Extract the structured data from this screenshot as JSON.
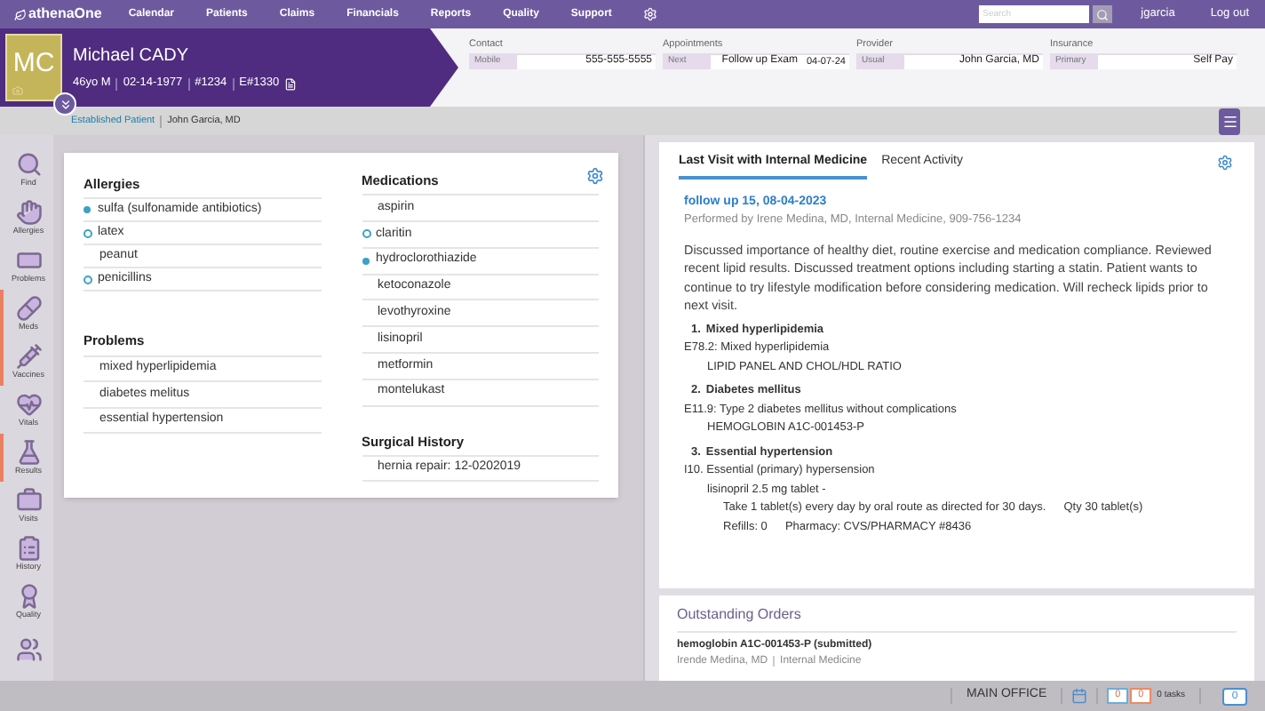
{
  "nav": {
    "logo": "athenaOne",
    "items": [
      "Calendar",
      "Patients",
      "Claims",
      "Financials",
      "Reports",
      "Quality",
      "Support"
    ],
    "search": {
      "placeholder": "Search"
    },
    "user": "jgarcia",
    "logout": "Log out"
  },
  "patient": {
    "initials": "MC",
    "name": "Michael CADY",
    "details": [
      "46yo M",
      "02-14-1977",
      "#1234",
      "E#1330"
    ],
    "fields": [
      {
        "heading": "Contact",
        "label": "Mobile",
        "value": "555-555-5555"
      },
      {
        "heading": "Appointments",
        "label": "Next",
        "value": "Follow up Exam",
        "extra": "04-07-24"
      },
      {
        "heading": "Provider",
        "label": "Usual",
        "value": "John Garcia, MD"
      },
      {
        "heading": "Insurance",
        "label": "Primary",
        "value": "Self Pay"
      }
    ],
    "status": "Established Patient",
    "provider": "John Garcia, MD"
  },
  "sidebar": [
    {
      "label": "Find",
      "flagged": false
    },
    {
      "label": "Allergies",
      "flagged": false
    },
    {
      "label": "Problems",
      "flagged": false
    },
    {
      "label": "Meds",
      "flagged": true
    },
    {
      "label": "Vaccines",
      "flagged": true
    },
    {
      "label": "Vitals",
      "flagged": false
    },
    {
      "label": "Results",
      "flagged": true
    },
    {
      "label": "Visits",
      "flagged": false
    },
    {
      "label": "History",
      "flagged": false
    },
    {
      "label": "Quality",
      "flagged": false
    },
    {
      "flagged": false
    }
  ],
  "summary": {
    "allergies": {
      "title": "Allergies",
      "items": [
        {
          "text": "sulfa (sulfonamide antibiotics)",
          "kind": "filled"
        },
        {
          "text": "latex",
          "kind": "hollow"
        },
        {
          "text": "peanut",
          "kind": "plain"
        },
        {
          "text": "penicillins",
          "kind": "hollow"
        }
      ]
    },
    "problems": {
      "title": "Problems",
      "items": [
        {
          "text": "mixed hyperlipidemia"
        },
        {
          "text": "diabetes melitus"
        },
        {
          "text": "essential hypertension"
        }
      ]
    },
    "medications": {
      "title": "Medications",
      "items": [
        {
          "text": "aspirin",
          "kind": "plain"
        },
        {
          "text": "claritin",
          "kind": "hollow"
        },
        {
          "text": "hydroclorothiazide",
          "kind": "filled"
        },
        {
          "text": "ketoconazole",
          "kind": "plain"
        },
        {
          "text": "levothyroxine",
          "kind": "plain"
        },
        {
          "text": "lisinopril",
          "kind": "plain"
        },
        {
          "text": "metformin",
          "kind": "plain"
        },
        {
          "text": "montelukast",
          "kind": "plain"
        }
      ]
    },
    "surgical": {
      "title": "Surgical History",
      "items": [
        {
          "text": "hernia repair: 12-0202019"
        }
      ]
    }
  },
  "visit": {
    "tabs": [
      {
        "label": "Last Visit with Internal Medicine",
        "selected": true
      },
      {
        "label": "Recent Activity",
        "selected": false
      }
    ],
    "title": "follow up 15, 08-04-2023",
    "performed_by": "Performed by Irene Medina, MD, Internal Medicine, 909-756-1234",
    "note": "Discussed importance of healthy diet, routine exercise and medication compliance. Reviewed recent lipid results.  Discussed treatment options including starting a statin. Patient wants to continue to try lifestyle modification before considering medication. Will recheck lipids prior to next visit.",
    "problems": [
      {
        "number": "1.",
        "title": "Mixed hyperlipidemia",
        "diagnosis": "E78.2: Mixed hyperlipidemia",
        "orders": [
          {
            "text": "LIPID PANEL AND CHOL/HDL RATIO"
          }
        ]
      },
      {
        "number": "2.",
        "title": "Diabetes mellitus",
        "diagnosis": "E11.9: Type 2 diabetes mellitus without complications",
        "orders": [
          {
            "text": "HEMOGLOBIN A1C-001453-P"
          }
        ]
      },
      {
        "number": "3.",
        "title": "Essential hypertension",
        "diagnosis": "I10. Essential (primary) hypersension",
        "orders": [
          {
            "text": "lisinopril 2.5 mg tablet -",
            "lines": [
              [
                "Take 1 tablet(s) every day by oral route as directed for 30 days.",
                "Qty 30 tablet(s)"
              ],
              [
                "Refills: 0",
                "Pharmacy: CVS/PHARMACY #8436"
              ]
            ]
          }
        ]
      }
    ]
  },
  "orders": {
    "title": "Outstanding Orders",
    "items": [
      {
        "name": "hemoglobin  A1C-001453-P (submitted)",
        "provider": "Irende Medina, MD",
        "department": "Internal Medicine"
      }
    ]
  },
  "status_bar": {
    "location": "MAIN OFFICE",
    "counts": [
      {
        "value": "0",
        "color": "#6aaedc"
      },
      {
        "value": "0",
        "color": "#e98b62"
      }
    ],
    "tasks": "0 tasks",
    "messages": "0"
  }
}
